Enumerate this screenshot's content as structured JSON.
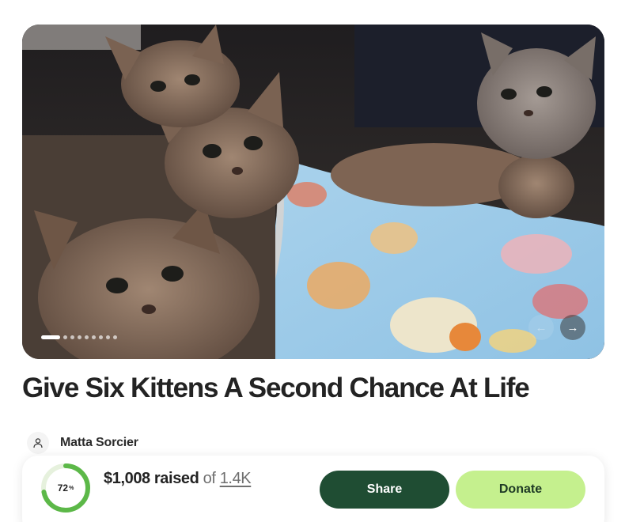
{
  "hero": {
    "image_alt": "Six tabby kittens on a light blue patterned blanket",
    "slide_count": 9,
    "active_slide": 1
  },
  "campaign": {
    "title": "Give Six Kittens A Second Chance At Life"
  },
  "organizer": {
    "name": "Matta Sorcier"
  },
  "progress": {
    "percent_value": 72,
    "percent_label": "72",
    "percent_sign": "%",
    "raised_label": "$1,008 raised",
    "of_label": "of",
    "goal_label": "1.4K"
  },
  "actions": {
    "share_label": "Share",
    "donate_label": "Donate"
  },
  "colors": {
    "share_bg": "#1f4d33",
    "donate_bg": "#c5f08e",
    "progress_green": "#5cb848"
  }
}
